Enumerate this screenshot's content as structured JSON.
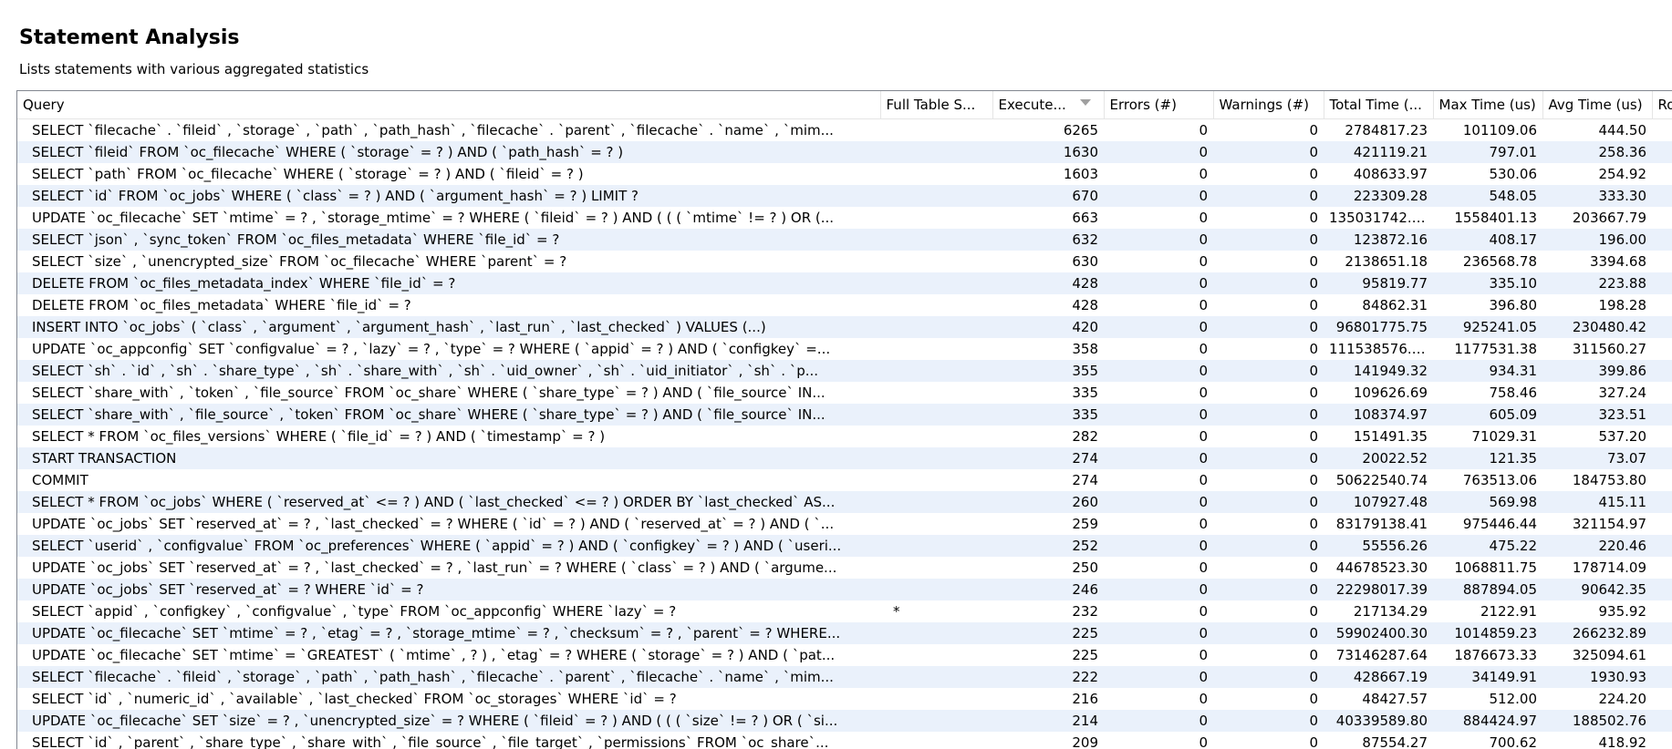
{
  "header": {
    "title": "Statement Analysis",
    "subtitle": "Lists statements with various aggregated statistics"
  },
  "table": {
    "columns": [
      "Query",
      "Full Table S...",
      "Execute...",
      "Errors (#)",
      "Warnings (#)",
      "Total Time (...",
      "Max Time (us)",
      "Avg Time (us)",
      "Ro"
    ],
    "sorted_column": "Execute...",
    "sort_direction": "descending",
    "rows": [
      {
        "query": "SELECT `filecache` . `fileid` , `storage` , `path` , `path_hash` , `filecache` . `parent` , `filecache` . `name` , `mim...",
        "fts": "",
        "exec": "6265",
        "errors": "0",
        "warnings": "0",
        "total": "2784817.23",
        "max": "101109.06",
        "avg": "444.50",
        "ro": ""
      },
      {
        "query": "SELECT `fileid` FROM `oc_filecache` WHERE ( `storage` = ? ) AND ( `path_hash` = ? )",
        "fts": "",
        "exec": "1630",
        "errors": "0",
        "warnings": "0",
        "total": "421119.21",
        "max": "797.01",
        "avg": "258.36",
        "ro": ""
      },
      {
        "query": "SELECT `path` FROM `oc_filecache` WHERE ( `storage` = ? ) AND ( `fileid` = ? )",
        "fts": "",
        "exec": "1603",
        "errors": "0",
        "warnings": "0",
        "total": "408633.97",
        "max": "530.06",
        "avg": "254.92",
        "ro": ""
      },
      {
        "query": "SELECT `id` FROM `oc_jobs` WHERE ( `class` = ? ) AND ( `argument_hash` = ? ) LIMIT ?",
        "fts": "",
        "exec": "670",
        "errors": "0",
        "warnings": "0",
        "total": "223309.28",
        "max": "548.05",
        "avg": "333.30",
        "ro": ""
      },
      {
        "query": "UPDATE `oc_filecache` SET `mtime` = ? , `storage_mtime` = ? WHERE ( `fileid` = ? ) AND ( ( ( `mtime` != ? ) OR (...",
        "fts": "",
        "exec": "663",
        "errors": "0",
        "warnings": "0",
        "total": "135031742.69",
        "max": "1558401.13",
        "avg": "203667.79",
        "ro": ""
      },
      {
        "query": "SELECT `json` , `sync_token` FROM `oc_files_metadata` WHERE `file_id` = ?",
        "fts": "",
        "exec": "632",
        "errors": "0",
        "warnings": "0",
        "total": "123872.16",
        "max": "408.17",
        "avg": "196.00",
        "ro": ""
      },
      {
        "query": "SELECT `size` , `unencrypted_size` FROM `oc_filecache` WHERE `parent` = ?",
        "fts": "",
        "exec": "630",
        "errors": "0",
        "warnings": "0",
        "total": "2138651.18",
        "max": "236568.78",
        "avg": "3394.68",
        "ro": ""
      },
      {
        "query": "DELETE FROM `oc_files_metadata_index` WHERE `file_id` = ?",
        "fts": "",
        "exec": "428",
        "errors": "0",
        "warnings": "0",
        "total": "95819.77",
        "max": "335.10",
        "avg": "223.88",
        "ro": ""
      },
      {
        "query": "DELETE FROM `oc_files_metadata` WHERE `file_id` = ?",
        "fts": "",
        "exec": "428",
        "errors": "0",
        "warnings": "0",
        "total": "84862.31",
        "max": "396.80",
        "avg": "198.28",
        "ro": ""
      },
      {
        "query": "INSERT INTO `oc_jobs` ( `class` , `argument` , `argument_hash` , `last_run` , `last_checked` ) VALUES (...)",
        "fts": "",
        "exec": "420",
        "errors": "0",
        "warnings": "0",
        "total": "96801775.75",
        "max": "925241.05",
        "avg": "230480.42",
        "ro": ""
      },
      {
        "query": "UPDATE `oc_appconfig` SET `configvalue` = ? , `lazy` = ? , `type` = ? WHERE ( `appid` = ? ) AND ( `configkey` =...",
        "fts": "",
        "exec": "358",
        "errors": "0",
        "warnings": "0",
        "total": "111538576.40",
        "max": "1177531.38",
        "avg": "311560.27",
        "ro": ""
      },
      {
        "query": "SELECT `sh` . `id` , `sh` . `share_type` , `sh` . `share_with` , `sh` . `uid_owner` , `sh` . `uid_initiator` , `sh` . `p...",
        "fts": "",
        "exec": "355",
        "errors": "0",
        "warnings": "0",
        "total": "141949.32",
        "max": "934.31",
        "avg": "399.86",
        "ro": ""
      },
      {
        "query": "SELECT `share_with` , `token` , `file_source` FROM `oc_share` WHERE ( `share_type` = ? ) AND ( `file_source` IN...",
        "fts": "",
        "exec": "335",
        "errors": "0",
        "warnings": "0",
        "total": "109626.69",
        "max": "758.46",
        "avg": "327.24",
        "ro": ""
      },
      {
        "query": "SELECT `share_with` , `file_source` , `token` FROM `oc_share` WHERE ( `share_type` = ? ) AND ( `file_source` IN...",
        "fts": "",
        "exec": "335",
        "errors": "0",
        "warnings": "0",
        "total": "108374.97",
        "max": "605.09",
        "avg": "323.51",
        "ro": ""
      },
      {
        "query": "SELECT * FROM `oc_files_versions` WHERE ( `file_id` = ? ) AND ( `timestamp` = ? )",
        "fts": "",
        "exec": "282",
        "errors": "0",
        "warnings": "0",
        "total": "151491.35",
        "max": "71029.31",
        "avg": "537.20",
        "ro": ""
      },
      {
        "query": "START TRANSACTION",
        "fts": "",
        "exec": "274",
        "errors": "0",
        "warnings": "0",
        "total": "20022.52",
        "max": "121.35",
        "avg": "73.07",
        "ro": ""
      },
      {
        "query": "COMMIT",
        "fts": "",
        "exec": "274",
        "errors": "0",
        "warnings": "0",
        "total": "50622540.74",
        "max": "763513.06",
        "avg": "184753.80",
        "ro": ""
      },
      {
        "query": "SELECT * FROM `oc_jobs` WHERE ( `reserved_at` <= ? ) AND ( `last_checked` <= ? ) ORDER BY `last_checked` AS...",
        "fts": "",
        "exec": "260",
        "errors": "0",
        "warnings": "0",
        "total": "107927.48",
        "max": "569.98",
        "avg": "415.11",
        "ro": ""
      },
      {
        "query": "UPDATE `oc_jobs` SET `reserved_at` = ? , `last_checked` = ? WHERE ( `id` = ? ) AND ( `reserved_at` = ? ) AND ( `...",
        "fts": "",
        "exec": "259",
        "errors": "0",
        "warnings": "0",
        "total": "83179138.41",
        "max": "975446.44",
        "avg": "321154.97",
        "ro": ""
      },
      {
        "query": "SELECT `userid` , `configvalue` FROM `oc_preferences` WHERE ( `appid` = ? ) AND ( `configkey` = ? ) AND ( `useri...",
        "fts": "",
        "exec": "252",
        "errors": "0",
        "warnings": "0",
        "total": "55556.26",
        "max": "475.22",
        "avg": "220.46",
        "ro": ""
      },
      {
        "query": "UPDATE `oc_jobs` SET `reserved_at` = ? , `last_checked` = ? , `last_run` = ? WHERE ( `class` = ? ) AND ( `argume...",
        "fts": "",
        "exec": "250",
        "errors": "0",
        "warnings": "0",
        "total": "44678523.30",
        "max": "1068811.75",
        "avg": "178714.09",
        "ro": ""
      },
      {
        "query": "UPDATE `oc_jobs` SET `reserved_at` = ? WHERE `id` = ?",
        "fts": "",
        "exec": "246",
        "errors": "0",
        "warnings": "0",
        "total": "22298017.39",
        "max": "887894.05",
        "avg": "90642.35",
        "ro": ""
      },
      {
        "query": "SELECT `appid` , `configkey` , `configvalue` , `type` FROM `oc_appconfig` WHERE `lazy` = ?",
        "fts": "*",
        "exec": "232",
        "errors": "0",
        "warnings": "0",
        "total": "217134.29",
        "max": "2122.91",
        "avg": "935.92",
        "ro": ""
      },
      {
        "query": "UPDATE `oc_filecache` SET `mtime` = ? , `etag` = ? , `storage_mtime` = ? , `checksum` = ? , `parent` = ? WHERE...",
        "fts": "",
        "exec": "225",
        "errors": "0",
        "warnings": "0",
        "total": "59902400.30",
        "max": "1014859.23",
        "avg": "266232.89",
        "ro": ""
      },
      {
        "query": "UPDATE `oc_filecache` SET `mtime` = `GREATEST` ( `mtime` , ? ) , `etag` = ? WHERE ( `storage` = ? ) AND ( `pat...",
        "fts": "",
        "exec": "225",
        "errors": "0",
        "warnings": "0",
        "total": "73146287.64",
        "max": "1876673.33",
        "avg": "325094.61",
        "ro": ""
      },
      {
        "query": "SELECT `filecache` . `fileid` , `storage` , `path` , `path_hash` , `filecache` . `parent` , `filecache` . `name` , `mim...",
        "fts": "",
        "exec": "222",
        "errors": "0",
        "warnings": "0",
        "total": "428667.19",
        "max": "34149.91",
        "avg": "1930.93",
        "ro": ""
      },
      {
        "query": "SELECT `id` , `numeric_id` , `available` , `last_checked` FROM `oc_storages` WHERE `id` = ?",
        "fts": "",
        "exec": "216",
        "errors": "0",
        "warnings": "0",
        "total": "48427.57",
        "max": "512.00",
        "avg": "224.20",
        "ro": ""
      },
      {
        "query": "UPDATE `oc_filecache` SET `size` = ? , `unencrypted_size` = ? WHERE ( `fileid` = ? ) AND ( ( ( `size` != ? ) OR ( `si...",
        "fts": "",
        "exec": "214",
        "errors": "0",
        "warnings": "0",
        "total": "40339589.80",
        "max": "884424.97",
        "avg": "188502.76",
        "ro": ""
      },
      {
        "query": "SELECT `id` , `parent` , `share_type` , `share_with` , `file_source` , `file_target` , `permissions` FROM `oc_share`...",
        "fts": "",
        "exec": "209",
        "errors": "0",
        "warnings": "0",
        "total": "87554.27",
        "max": "700.62",
        "avg": "418.92",
        "ro": ""
      }
    ]
  }
}
